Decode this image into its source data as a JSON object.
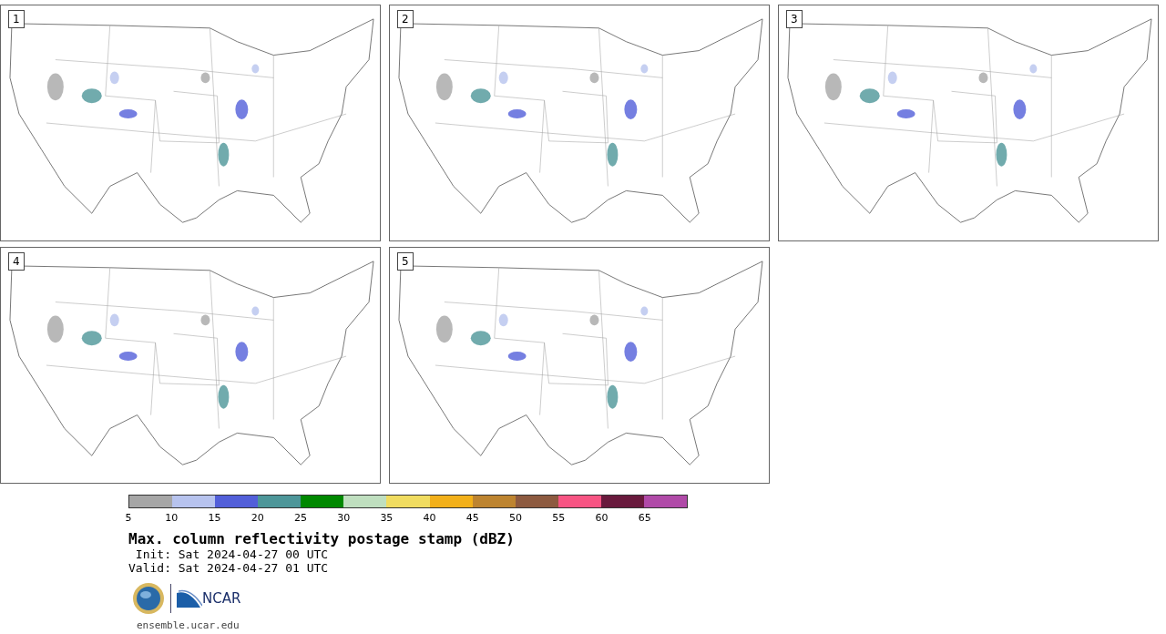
{
  "panels": [
    {
      "label": "1"
    },
    {
      "label": "2"
    },
    {
      "label": "3"
    },
    {
      "label": "4"
    },
    {
      "label": "5"
    }
  ],
  "colorbar": {
    "segments": [
      {
        "color": "#a6a6a6"
      },
      {
        "color": "#b7c3ee"
      },
      {
        "color": "#525fd9"
      },
      {
        "color": "#4d9699"
      },
      {
        "color": "#008800"
      },
      {
        "color": "#bfdfbf"
      },
      {
        "color": "#f0dc60"
      },
      {
        "color": "#f2b01a"
      },
      {
        "color": "#bd8430"
      },
      {
        "color": "#8d5a40"
      },
      {
        "color": "#f75483"
      },
      {
        "color": "#691a3d"
      },
      {
        "color": "#b04aa8"
      }
    ],
    "ticks": [
      "5",
      "10",
      "15",
      "20",
      "25",
      "30",
      "35",
      "40",
      "45",
      "50",
      "55",
      "60",
      "65"
    ]
  },
  "title": "Max. column reflectivity postage stamp (dBZ)",
  "init": " Init: Sat 2024-04-27 00 UTC",
  "valid": "Valid: Sat 2024-04-27 01 UTC",
  "logo_text": "NCAR",
  "footer_link": "ensemble.ucar.edu"
}
